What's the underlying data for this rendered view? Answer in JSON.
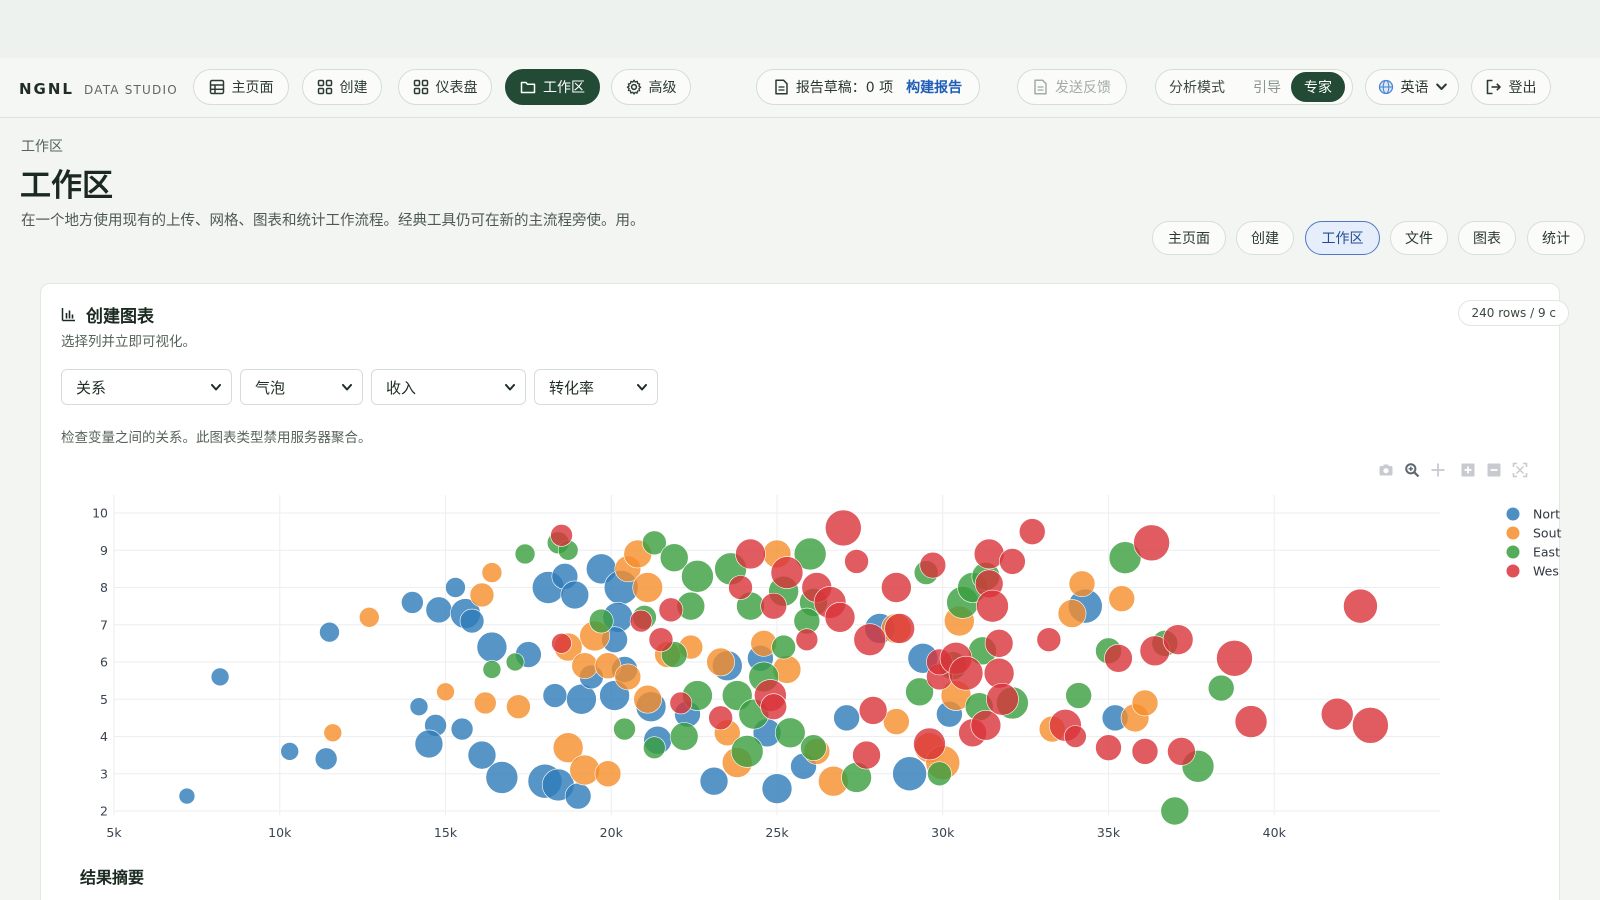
{
  "brand": {
    "logo": "NGNL",
    "sub": "DATA STUDIO"
  },
  "nav": {
    "items": [
      {
        "label": "主页面",
        "icon": "table-icon"
      },
      {
        "label": "创建",
        "icon": "grid-icon"
      },
      {
        "label": "仪表盘",
        "icon": "dashboard-icon"
      },
      {
        "label": "工作区",
        "icon": "folder-icon"
      },
      {
        "label": "高级",
        "icon": "gear-icon"
      }
    ],
    "report": {
      "label": "报告草稿：0 项",
      "link": "构建报告"
    },
    "feedback": "发送反馈",
    "mode": {
      "label": "分析模式",
      "options": [
        "引导",
        "专家"
      ],
      "selected": "专家"
    },
    "language": "英语",
    "logout": "登出"
  },
  "page": {
    "breadcrumb": "工作区",
    "title": "工作区",
    "description": "在一个地方使用现有的上传、网格、图表和统计工作流程。经典工具仍可在新的主流程旁使。用。"
  },
  "subtabs": [
    "主页面",
    "创建",
    "工作区",
    "文件",
    "图表",
    "统计"
  ],
  "subtab_active": "工作区",
  "card": {
    "title": "创建图表",
    "subtitle": "选择列并立即可视化。",
    "row_badge": "240 rows / 9 c",
    "selects": [
      "关系",
      "气泡",
      "收入",
      "转化率"
    ],
    "hint": "检查变量之间的关系。此图表类型禁用服务器聚合。",
    "summary_title": "结果摘要"
  },
  "chart_data": {
    "type": "scatter",
    "subtype": "bubble",
    "xlabel": "",
    "ylabel": "",
    "xlim": [
      5000,
      45000
    ],
    "ylim": [
      2,
      10
    ],
    "x_ticks": [
      "5k",
      "10k",
      "15k",
      "20k",
      "25k",
      "30k",
      "35k",
      "40k"
    ],
    "x_tick_values": [
      5000,
      10000,
      15000,
      20000,
      25000,
      30000,
      35000,
      40000
    ],
    "y_ticks": [
      2,
      3,
      4,
      5,
      6,
      7,
      8,
      9,
      10
    ],
    "grid": true,
    "legend_position": "right",
    "legend_labels": [
      "Nort",
      "Sout",
      "East",
      "Wes"
    ],
    "colors": {
      "North": "#2e7bb9",
      "South": "#f68d2a",
      "East": "#3a9e3f",
      "West": "#d9333a"
    },
    "series": [
      {
        "name": "North",
        "color": "#2e7bb9",
        "points": [
          [
            7200,
            2.4,
            8
          ],
          [
            8200,
            5.6,
            9
          ],
          [
            10300,
            3.6,
            9
          ],
          [
            11400,
            3.4,
            11
          ],
          [
            11500,
            6.8,
            10
          ],
          [
            14000,
            7.6,
            11
          ],
          [
            14800,
            7.4,
            13
          ],
          [
            15300,
            8.0,
            10
          ],
          [
            15600,
            7.3,
            15
          ],
          [
            15800,
            7.1,
            12
          ],
          [
            16400,
            6.4,
            15
          ],
          [
            14200,
            4.8,
            9
          ],
          [
            14700,
            4.3,
            11
          ],
          [
            15500,
            4.2,
            11
          ],
          [
            14500,
            3.8,
            14
          ],
          [
            16100,
            3.5,
            14
          ],
          [
            16700,
            2.9,
            16
          ],
          [
            18000,
            2.8,
            17
          ],
          [
            18400,
            2.7,
            16
          ],
          [
            19000,
            2.4,
            13
          ],
          [
            18100,
            8.0,
            16
          ],
          [
            18600,
            8.3,
            13
          ],
          [
            18900,
            7.8,
            14
          ],
          [
            19700,
            8.5,
            15
          ],
          [
            20300,
            8.0,
            17
          ],
          [
            20200,
            7.2,
            15
          ],
          [
            20100,
            6.6,
            13
          ],
          [
            20400,
            5.8,
            13
          ],
          [
            20100,
            5.1,
            15
          ],
          [
            19100,
            5.0,
            15
          ],
          [
            18300,
            5.1,
            12
          ],
          [
            17500,
            6.2,
            13
          ],
          [
            19400,
            5.6,
            12
          ],
          [
            21200,
            4.8,
            15
          ],
          [
            21400,
            3.9,
            14
          ],
          [
            22300,
            4.6,
            13
          ],
          [
            23100,
            2.8,
            14
          ],
          [
            23500,
            5.9,
            15
          ],
          [
            24500,
            6.1,
            13
          ],
          [
            24700,
            4.1,
            14
          ],
          [
            25000,
            2.6,
            15
          ],
          [
            25800,
            3.2,
            13
          ],
          [
            27100,
            4.5,
            13
          ],
          [
            28100,
            6.9,
            15
          ],
          [
            29000,
            3.0,
            17
          ],
          [
            29400,
            6.1,
            15
          ],
          [
            30200,
            4.6,
            13
          ],
          [
            34300,
            7.5,
            17
          ],
          [
            35200,
            4.5,
            13
          ]
        ]
      },
      {
        "name": "South",
        "color": "#f68d2a",
        "points": [
          [
            12700,
            7.2,
            10
          ],
          [
            11600,
            4.1,
            9
          ],
          [
            16100,
            7.8,
            12
          ],
          [
            16400,
            8.4,
            10
          ],
          [
            15000,
            5.2,
            9
          ],
          [
            16200,
            4.9,
            11
          ],
          [
            17200,
            4.8,
            12
          ],
          [
            19500,
            6.7,
            15
          ],
          [
            18700,
            6.4,
            14
          ],
          [
            19200,
            5.9,
            13
          ],
          [
            19900,
            5.9,
            13
          ],
          [
            20500,
            5.6,
            13
          ],
          [
            21100,
            5.0,
            14
          ],
          [
            18700,
            3.7,
            15
          ],
          [
            19200,
            3.1,
            15
          ],
          [
            19900,
            3.0,
            13
          ],
          [
            20500,
            8.5,
            13
          ],
          [
            20800,
            8.9,
            14
          ],
          [
            21100,
            8.0,
            15
          ],
          [
            21700,
            6.2,
            13
          ],
          [
            22400,
            6.4,
            12
          ],
          [
            23300,
            6.0,
            14
          ],
          [
            23500,
            4.1,
            13
          ],
          [
            23800,
            3.3,
            15
          ],
          [
            24600,
            6.5,
            13
          ],
          [
            25000,
            8.9,
            14
          ],
          [
            25300,
            5.8,
            14
          ],
          [
            26200,
            3.6,
            13
          ],
          [
            26700,
            2.8,
            15
          ],
          [
            28600,
            4.4,
            13
          ],
          [
            28600,
            6.9,
            15
          ],
          [
            29600,
            3.7,
            15
          ],
          [
            30000,
            3.3,
            17
          ],
          [
            30400,
            5.1,
            15
          ],
          [
            30500,
            7.1,
            15
          ],
          [
            33900,
            7.3,
            14
          ],
          [
            34200,
            8.1,
            13
          ],
          [
            35400,
            7.7,
            13
          ],
          [
            35800,
            4.5,
            14
          ],
          [
            36100,
            4.9,
            13
          ],
          [
            33300,
            4.2,
            13
          ]
        ]
      },
      {
        "name": "East",
        "color": "#3a9e3f",
        "points": [
          [
            17400,
            8.9,
            10
          ],
          [
            18400,
            9.2,
            11
          ],
          [
            18700,
            9.0,
            10
          ],
          [
            16400,
            5.8,
            9
          ],
          [
            17100,
            6.0,
            9
          ],
          [
            19700,
            7.1,
            12
          ],
          [
            21000,
            7.2,
            12
          ],
          [
            21300,
            9.2,
            12
          ],
          [
            21900,
            8.8,
            14
          ],
          [
            22600,
            8.3,
            16
          ],
          [
            22400,
            7.5,
            14
          ],
          [
            21900,
            6.2,
            13
          ],
          [
            22600,
            5.1,
            15
          ],
          [
            22200,
            4.0,
            14
          ],
          [
            21300,
            3.7,
            11
          ],
          [
            20400,
            4.2,
            11
          ],
          [
            23600,
            8.5,
            16
          ],
          [
            24200,
            7.5,
            14
          ],
          [
            25200,
            7.9,
            15
          ],
          [
            26000,
            8.9,
            16
          ],
          [
            26100,
            7.6,
            14
          ],
          [
            25900,
            7.1,
            13
          ],
          [
            25200,
            6.4,
            12
          ],
          [
            24600,
            5.6,
            15
          ],
          [
            23800,
            5.1,
            15
          ],
          [
            24300,
            4.6,
            15
          ],
          [
            24100,
            3.6,
            16
          ],
          [
            25400,
            4.1,
            15
          ],
          [
            26100,
            3.7,
            13
          ],
          [
            27400,
            2.9,
            15
          ],
          [
            29500,
            8.4,
            12
          ],
          [
            29300,
            5.2,
            14
          ],
          [
            29900,
            3.0,
            12
          ],
          [
            30300,
            5.9,
            14
          ],
          [
            30600,
            7.6,
            16
          ],
          [
            30900,
            8.0,
            15
          ],
          [
            31300,
            8.3,
            14
          ],
          [
            31200,
            6.3,
            14
          ],
          [
            31100,
            4.8,
            14
          ],
          [
            32100,
            4.9,
            16
          ],
          [
            34100,
            5.1,
            13
          ],
          [
            35000,
            6.3,
            13
          ],
          [
            35500,
            8.8,
            16
          ],
          [
            36700,
            6.5,
            13
          ],
          [
            37000,
            2.0,
            14
          ],
          [
            37700,
            3.2,
            16
          ],
          [
            38400,
            5.3,
            13
          ]
        ]
      },
      {
        "name": "West",
        "color": "#d9333a",
        "points": [
          [
            18500,
            9.4,
            11
          ],
          [
            18500,
            6.5,
            10
          ],
          [
            20900,
            7.1,
            11
          ],
          [
            21500,
            6.6,
            12
          ],
          [
            21800,
            7.4,
            12
          ],
          [
            22100,
            4.9,
            11
          ],
          [
            23300,
            4.5,
            12
          ],
          [
            23900,
            8.0,
            12
          ],
          [
            24200,
            8.9,
            15
          ],
          [
            24800,
            5.1,
            16
          ],
          [
            24900,
            4.8,
            13
          ],
          [
            24900,
            7.5,
            13
          ],
          [
            25300,
            8.4,
            16
          ],
          [
            25900,
            6.6,
            11
          ],
          [
            26200,
            8.0,
            15
          ],
          [
            26600,
            7.6,
            16
          ],
          [
            26900,
            7.2,
            15
          ],
          [
            27000,
            9.6,
            18
          ],
          [
            27400,
            8.7,
            12
          ],
          [
            27800,
            6.6,
            16
          ],
          [
            27900,
            4.7,
            14
          ],
          [
            27700,
            3.5,
            14
          ],
          [
            28600,
            8.0,
            15
          ],
          [
            28700,
            6.9,
            15
          ],
          [
            29600,
            3.8,
            16
          ],
          [
            29700,
            8.6,
            13
          ],
          [
            29900,
            5.6,
            13
          ],
          [
            29900,
            6.0,
            13
          ],
          [
            30400,
            6.1,
            16
          ],
          [
            30700,
            5.7,
            17
          ],
          [
            30900,
            4.1,
            14
          ],
          [
            31300,
            4.3,
            15
          ],
          [
            31400,
            8.9,
            15
          ],
          [
            31400,
            8.1,
            14
          ],
          [
            31500,
            7.5,
            16
          ],
          [
            31700,
            6.5,
            14
          ],
          [
            31700,
            5.7,
            15
          ],
          [
            31800,
            5.0,
            16
          ],
          [
            32100,
            8.7,
            13
          ],
          [
            32700,
            9.5,
            13
          ],
          [
            33200,
            6.6,
            12
          ],
          [
            33700,
            4.3,
            16
          ],
          [
            34000,
            4.0,
            11
          ],
          [
            35000,
            3.7,
            13
          ],
          [
            35300,
            6.1,
            14
          ],
          [
            36100,
            3.6,
            13
          ],
          [
            36300,
            9.2,
            18
          ],
          [
            36400,
            6.3,
            15
          ],
          [
            37100,
            6.6,
            15
          ],
          [
            37200,
            3.6,
            14
          ],
          [
            38800,
            6.1,
            18
          ],
          [
            39300,
            4.4,
            16
          ],
          [
            41900,
            4.6,
            16
          ],
          [
            42600,
            7.5,
            17
          ],
          [
            42900,
            4.3,
            18
          ]
        ]
      }
    ]
  }
}
